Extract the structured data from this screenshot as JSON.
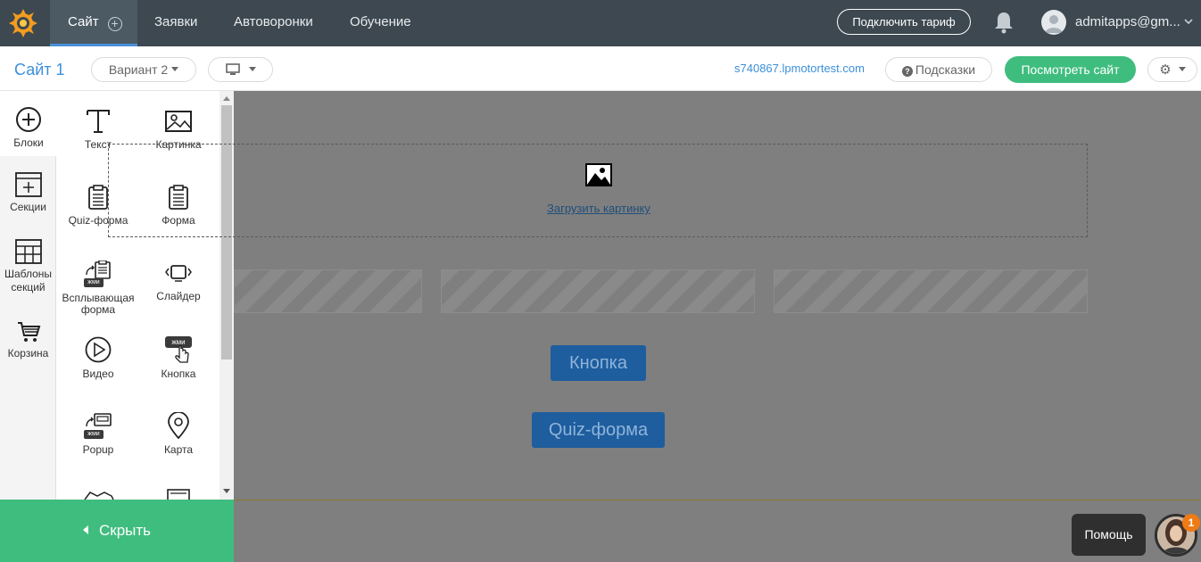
{
  "topbar": {
    "nav": [
      {
        "label": "Сайт"
      },
      {
        "label": "Заявки"
      },
      {
        "label": "Автоворонки"
      },
      {
        "label": "Обучение"
      }
    ],
    "tariff_button": "Подключить тариф",
    "user_email": "admitapps@gm..."
  },
  "subbar": {
    "site_title": "Сайт 1",
    "variant": "Вариант 2",
    "domain": "s740867.lpmotortest.com",
    "hints": "Подсказки",
    "view_site": "Посмотреть сайт"
  },
  "rail": [
    {
      "label": "Блоки",
      "icon": "plus-circle-icon"
    },
    {
      "label": "Секции",
      "icon": "section-icon"
    },
    {
      "label": "Шаблоны секций",
      "icon": "templates-icon"
    },
    {
      "label": "Корзина",
      "icon": "cart-icon"
    }
  ],
  "blocks": [
    {
      "label": "Текст",
      "icon": "text-icon"
    },
    {
      "label": "Картинка",
      "icon": "image-icon"
    },
    {
      "label": "Quiz-форма",
      "icon": "clipboard-icon"
    },
    {
      "label": "Форма",
      "icon": "clipboard-icon"
    },
    {
      "label": "Всплывающая форма",
      "icon": "popup-form-icon"
    },
    {
      "label": "Слайдер",
      "icon": "slider-icon"
    },
    {
      "label": "Видео",
      "icon": "play-icon"
    },
    {
      "label": "Кнопка",
      "icon": "button-click-icon"
    },
    {
      "label": "Popup",
      "icon": "popup-icon"
    },
    {
      "label": "Карта",
      "icon": "map-pin-icon"
    }
  ],
  "badge_text": "жми",
  "canvas": {
    "upload_link": "Загрузить картинку",
    "button_label": "Кнопка",
    "quiz_label": "Quiz-форма"
  },
  "hide_label": "Скрыть",
  "help": {
    "label": "Помощь",
    "badge": "1"
  },
  "colors": {
    "topbar": "#3d4850",
    "accent_blue": "#3b8fd9",
    "green": "#3fbd7e",
    "canvas_overlay": "#7f7f7f"
  }
}
